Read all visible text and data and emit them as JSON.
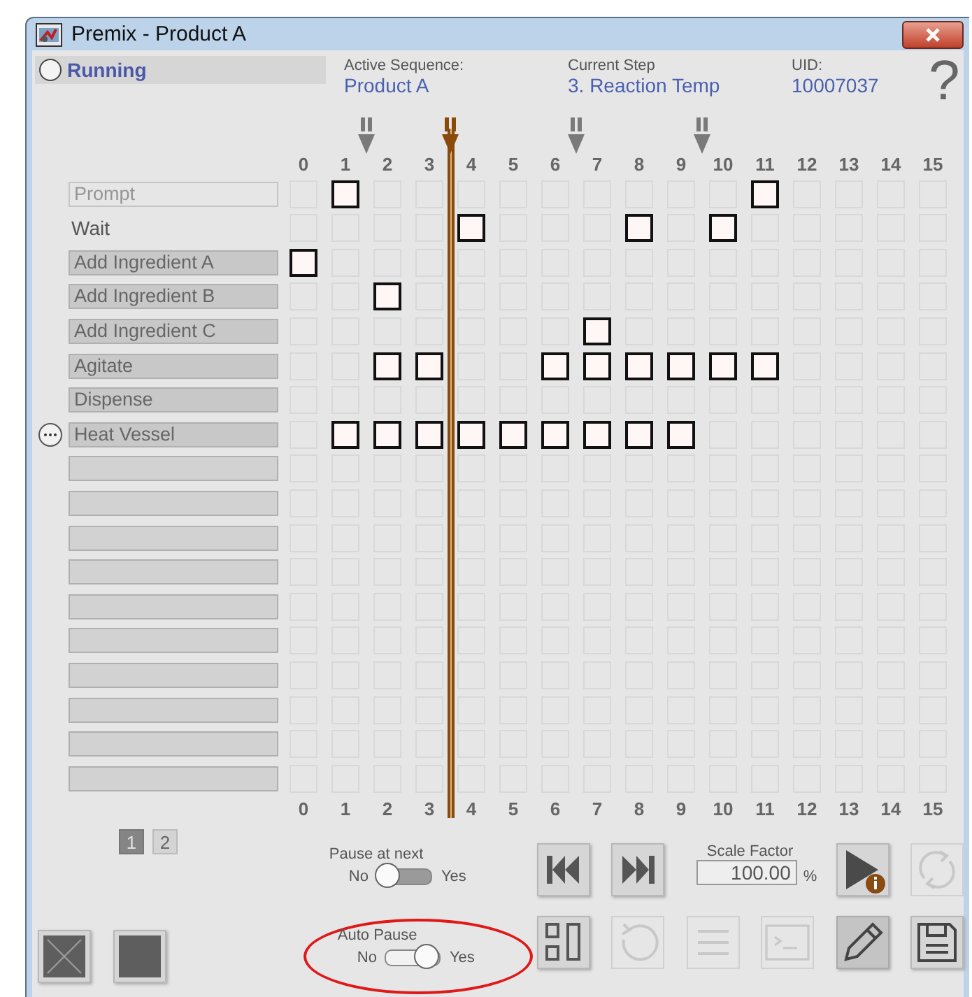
{
  "window": {
    "title": "Premix - Product A"
  },
  "status": {
    "label": "Running",
    "running": false
  },
  "info": [
    {
      "caption": "Active Sequence:",
      "value": "Product A"
    },
    {
      "caption": "Current Step",
      "value": "3. Reaction Temp"
    },
    {
      "caption": "UID:",
      "value": "10007037"
    }
  ],
  "help": "?",
  "columns": [
    {
      "label": "0",
      "pause": false,
      "current": false
    },
    {
      "label": "1",
      "pause": true,
      "current": false
    },
    {
      "label": "2",
      "pause": false,
      "current": false
    },
    {
      "label": "3",
      "pause": false,
      "current": true
    },
    {
      "label": "4",
      "pause": false,
      "current": false
    },
    {
      "label": "5",
      "pause": false,
      "current": false
    },
    {
      "label": "6",
      "pause": true,
      "current": false
    },
    {
      "label": "7",
      "pause": false,
      "current": false
    },
    {
      "label": "8",
      "pause": false,
      "current": false
    },
    {
      "label": "9",
      "pause": true,
      "current": false
    },
    {
      "label": "10",
      "pause": false,
      "current": false
    },
    {
      "label": "11",
      "pause": false,
      "current": false
    },
    {
      "label": "12",
      "pause": false,
      "current": false
    },
    {
      "label": "13",
      "pause": false,
      "current": false
    },
    {
      "label": "14",
      "pause": false,
      "current": false
    },
    {
      "label": "15",
      "pause": false,
      "current": false
    }
  ],
  "rows": [
    {
      "label": "Prompt",
      "kind": "box",
      "disabled": true,
      "menu": false,
      "steps": [
        false,
        true,
        false,
        false,
        false,
        false,
        false,
        false,
        false,
        false,
        false,
        true,
        false,
        false,
        false,
        false
      ]
    },
    {
      "label": "Wait",
      "kind": "plain",
      "disabled": false,
      "menu": false,
      "steps": [
        false,
        false,
        false,
        false,
        true,
        false,
        false,
        false,
        true,
        false,
        true,
        false,
        false,
        false,
        false,
        false
      ]
    },
    {
      "label": "Add Ingredient A",
      "kind": "box",
      "disabled": false,
      "menu": false,
      "steps": [
        true,
        false,
        false,
        false,
        false,
        false,
        false,
        false,
        false,
        false,
        false,
        false,
        false,
        false,
        false,
        false
      ]
    },
    {
      "label": "Add Ingredient B",
      "kind": "box",
      "disabled": false,
      "menu": false,
      "steps": [
        false,
        false,
        true,
        false,
        false,
        false,
        false,
        false,
        false,
        false,
        false,
        false,
        false,
        false,
        false,
        false
      ]
    },
    {
      "label": "Add Ingredient C",
      "kind": "box",
      "disabled": false,
      "menu": false,
      "steps": [
        false,
        false,
        false,
        false,
        false,
        false,
        false,
        true,
        false,
        false,
        false,
        false,
        false,
        false,
        false,
        false
      ]
    },
    {
      "label": "Agitate",
      "kind": "box",
      "disabled": false,
      "menu": false,
      "steps": [
        false,
        false,
        true,
        true,
        false,
        false,
        true,
        true,
        true,
        true,
        true,
        true,
        false,
        false,
        false,
        false
      ]
    },
    {
      "label": "Dispense",
      "kind": "box",
      "disabled": false,
      "menu": false,
      "steps": [
        false,
        false,
        false,
        false,
        false,
        false,
        false,
        false,
        false,
        false,
        false,
        false,
        false,
        false,
        false,
        false
      ]
    },
    {
      "label": "Heat Vessel",
      "kind": "box",
      "disabled": false,
      "menu": true,
      "steps": [
        false,
        true,
        true,
        true,
        true,
        true,
        true,
        true,
        true,
        true,
        false,
        false,
        false,
        false,
        false,
        false
      ]
    },
    {
      "kind": "empty",
      "steps": [
        false,
        false,
        false,
        false,
        false,
        false,
        false,
        false,
        false,
        false,
        false,
        false,
        false,
        false,
        false,
        false
      ]
    },
    {
      "kind": "empty",
      "steps": [
        false,
        false,
        false,
        false,
        false,
        false,
        false,
        false,
        false,
        false,
        false,
        false,
        false,
        false,
        false,
        false
      ]
    },
    {
      "kind": "empty",
      "steps": [
        false,
        false,
        false,
        false,
        false,
        false,
        false,
        false,
        false,
        false,
        false,
        false,
        false,
        false,
        false,
        false
      ]
    },
    {
      "kind": "empty",
      "steps": [
        false,
        false,
        false,
        false,
        false,
        false,
        false,
        false,
        false,
        false,
        false,
        false,
        false,
        false,
        false,
        false
      ]
    },
    {
      "kind": "empty",
      "steps": [
        false,
        false,
        false,
        false,
        false,
        false,
        false,
        false,
        false,
        false,
        false,
        false,
        false,
        false,
        false,
        false
      ]
    },
    {
      "kind": "empty",
      "steps": [
        false,
        false,
        false,
        false,
        false,
        false,
        false,
        false,
        false,
        false,
        false,
        false,
        false,
        false,
        false,
        false
      ]
    },
    {
      "kind": "empty",
      "steps": [
        false,
        false,
        false,
        false,
        false,
        false,
        false,
        false,
        false,
        false,
        false,
        false,
        false,
        false,
        false,
        false
      ]
    },
    {
      "kind": "empty",
      "steps": [
        false,
        false,
        false,
        false,
        false,
        false,
        false,
        false,
        false,
        false,
        false,
        false,
        false,
        false,
        false,
        false
      ]
    },
    {
      "kind": "empty",
      "steps": [
        false,
        false,
        false,
        false,
        false,
        false,
        false,
        false,
        false,
        false,
        false,
        false,
        false,
        false,
        false,
        false
      ]
    },
    {
      "kind": "empty",
      "steps": [
        false,
        false,
        false,
        false,
        false,
        false,
        false,
        false,
        false,
        false,
        false,
        false,
        false,
        false,
        false,
        false
      ]
    }
  ],
  "bottom_numbers": [
    "0",
    "1",
    "2",
    "3",
    "4",
    "5",
    "6",
    "7",
    "8",
    "9",
    "10",
    "11",
    "12",
    "13",
    "14",
    "15"
  ],
  "pages": [
    {
      "label": "1",
      "selected": true
    },
    {
      "label": "2",
      "selected": false
    }
  ],
  "toggles": [
    {
      "caption": "Pause at next",
      "off_label": "No",
      "on_label": "Yes",
      "on": false,
      "highlighted": false
    },
    {
      "caption": "Auto Pause",
      "off_label": "No",
      "on_label": "Yes",
      "on": true,
      "highlighted": true
    }
  ],
  "scale_factor": {
    "caption": "Scale Factor",
    "value": "100.00",
    "unit": "%"
  },
  "buttons": [
    {
      "kind": "skip-back",
      "disabled": false
    },
    {
      "kind": "skip-forward",
      "disabled": false
    },
    {
      "kind": "play-info",
      "disabled": false
    },
    {
      "kind": "refresh",
      "disabled": true
    },
    {
      "kind": "cancel",
      "disabled": false
    },
    {
      "kind": "stop",
      "disabled": false
    },
    {
      "kind": "layout",
      "disabled": false
    },
    {
      "kind": "undo",
      "disabled": true
    },
    {
      "kind": "list",
      "disabled": true
    },
    {
      "kind": "console",
      "disabled": true
    },
    {
      "kind": "edit",
      "disabled": false
    },
    {
      "kind": "save",
      "disabled": false
    }
  ]
}
